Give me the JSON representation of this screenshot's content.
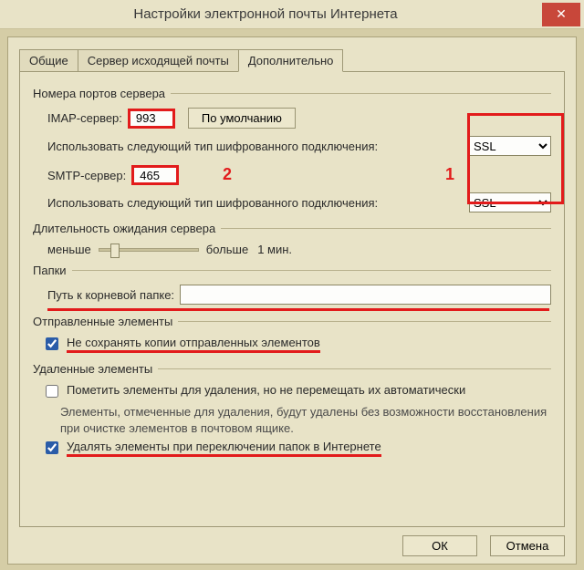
{
  "title": "Настройки электронной почты Интернета",
  "tabs": {
    "general": "Общие",
    "outgoing": "Сервер исходящей почты",
    "advanced": "Дополнительно"
  },
  "groups": {
    "ports": "Номера портов сервера",
    "timeout": "Длительность ожидания сервера",
    "folders": "Папки",
    "sent": "Отправленные элементы",
    "deleted": "Удаленные элементы"
  },
  "ports": {
    "imap_label": "IMAP-сервер:",
    "imap_value": "993",
    "default_btn": "По умолчанию",
    "smtp_label": "SMTP-сервер:",
    "smtp_value": "465",
    "encrypt_label": "Использовать следующий тип шифрованного подключения:",
    "ssl_imap": "SSL",
    "ssl_smtp": "SSL"
  },
  "timeout": {
    "less": "меньше",
    "more": "больше",
    "value": "1 мин."
  },
  "folders": {
    "root_label": "Путь к корневой папке:",
    "root_value": ""
  },
  "sent": {
    "dont_save": "Не сохранять копии отправленных элементов"
  },
  "deleted": {
    "mark": "Пометить элементы для удаления, но не перемещать их автоматически",
    "desc": "Элементы, отмеченные для удаления, будут удалены без возможности восстановления при очистке элементов в почтовом ящике.",
    "purge": "Удалять элементы при переключении папок в Интернете"
  },
  "buttons": {
    "ok": "ОК",
    "cancel": "Отмена"
  },
  "annotations": {
    "one": "1",
    "two": "2"
  }
}
